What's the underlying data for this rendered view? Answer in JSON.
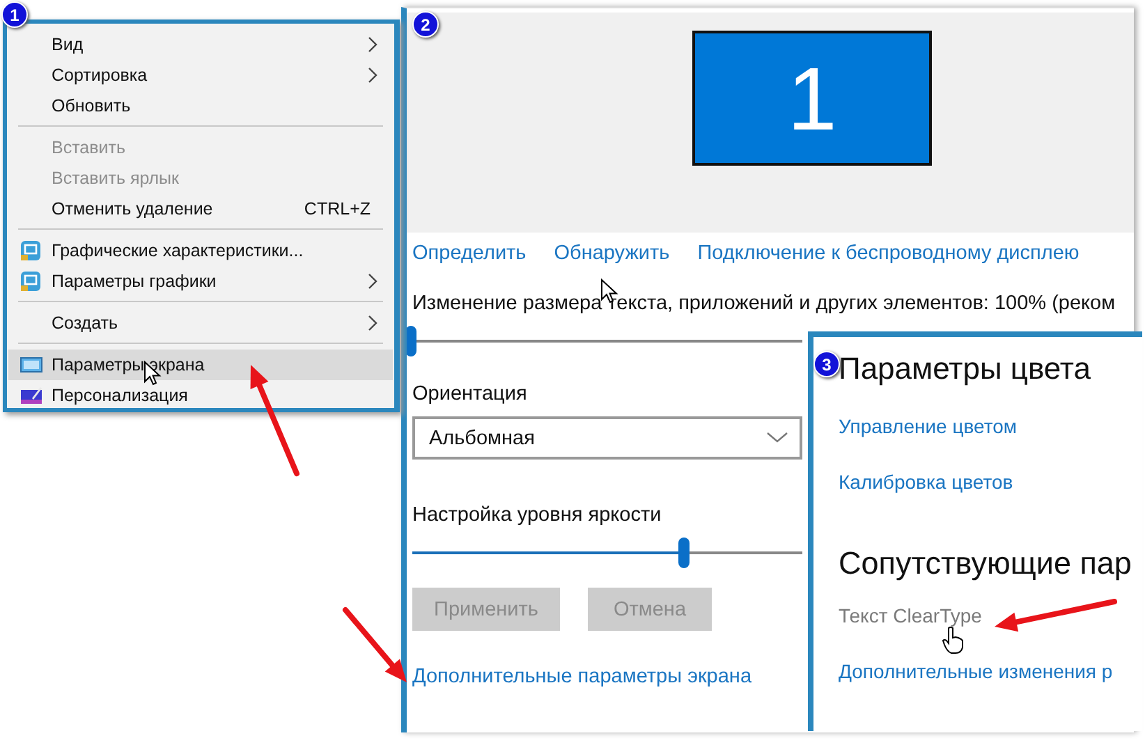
{
  "menu": {
    "badge": "1",
    "items": [
      {
        "kind": "plain",
        "label": "Вид",
        "submenu": true,
        "disabled": false,
        "selected": false
      },
      {
        "kind": "plain",
        "label": "Сортировка",
        "submenu": true,
        "disabled": false,
        "selected": false
      },
      {
        "kind": "plain",
        "label": "Обновить",
        "submenu": false,
        "disabled": false,
        "selected": false
      },
      {
        "kind": "separator"
      },
      {
        "kind": "plain",
        "label": "Вставить",
        "submenu": false,
        "disabled": true,
        "selected": false
      },
      {
        "kind": "plain",
        "label": "Вставить ярлык",
        "submenu": false,
        "disabled": true,
        "selected": false
      },
      {
        "kind": "plain",
        "label": "Отменить удаление",
        "shortcut": "CTRL+Z",
        "submenu": false,
        "disabled": false,
        "selected": false
      },
      {
        "kind": "separator"
      },
      {
        "kind": "graphics",
        "label": "Графические характеристики...",
        "submenu": false,
        "disabled": false,
        "selected": false
      },
      {
        "kind": "graphics",
        "label": "Параметры графики",
        "submenu": true,
        "disabled": false,
        "selected": false
      },
      {
        "kind": "separator"
      },
      {
        "kind": "plain",
        "label": "Создать",
        "submenu": true,
        "disabled": false,
        "selected": false
      },
      {
        "kind": "separator"
      },
      {
        "kind": "screen",
        "label": "Параметры экрана",
        "submenu": false,
        "disabled": false,
        "selected": true
      },
      {
        "kind": "brush",
        "label": "Персонализация",
        "submenu": false,
        "disabled": false,
        "selected": false
      }
    ]
  },
  "display": {
    "badge": "2",
    "monitors": [
      {
        "label": "1",
        "selected": true
      }
    ],
    "links": [
      "Определить",
      "Обнаружить",
      "Подключение к беспроводному дисплею"
    ],
    "scale": {
      "label": "Изменение размера текста, приложений и других элементов: 100% (реком",
      "level": 0
    },
    "orientation": {
      "label": "Ориентация",
      "value": "Альбомная"
    },
    "brightness": {
      "label": "Настройка уровня яркости",
      "level": 0.7
    },
    "buttons": [
      {
        "label": "Применить",
        "disabled": true
      },
      {
        "label": "Отмена",
        "disabled": true
      }
    ],
    "advanced_link": "Дополнительные параметры экрана"
  },
  "color_panel": {
    "badge": "3",
    "title": "Параметры цвета",
    "links": [
      "Управление цветом",
      "Калибровка цветов"
    ],
    "related_title": "Сопутствующие пар",
    "related_links": [
      {
        "label": "Текст ClearType",
        "hovered": true
      },
      {
        "label": "Дополнительные изменения р",
        "hovered": false
      }
    ]
  }
}
